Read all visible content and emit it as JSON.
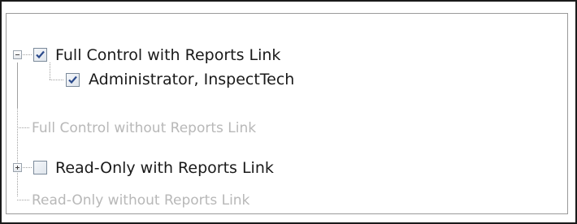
{
  "tree": {
    "items": [
      {
        "label": "Full Control with Reports Link",
        "checked": true,
        "expander": "minus",
        "enabled": true
      },
      {
        "label": "Administrator, InspectTech",
        "checked": true,
        "enabled": true
      },
      {
        "label": "Full Control without Reports Link",
        "enabled": false
      },
      {
        "label": "Read-Only with Reports Link",
        "checked": false,
        "expander": "plus",
        "enabled": true
      },
      {
        "label": "Read-Only without Reports Link",
        "enabled": false
      }
    ]
  },
  "colors": {
    "checkmark": "#2b4a8c",
    "disabled_text": "#b8b8b8",
    "tree_lines": "#a0a0a0"
  }
}
